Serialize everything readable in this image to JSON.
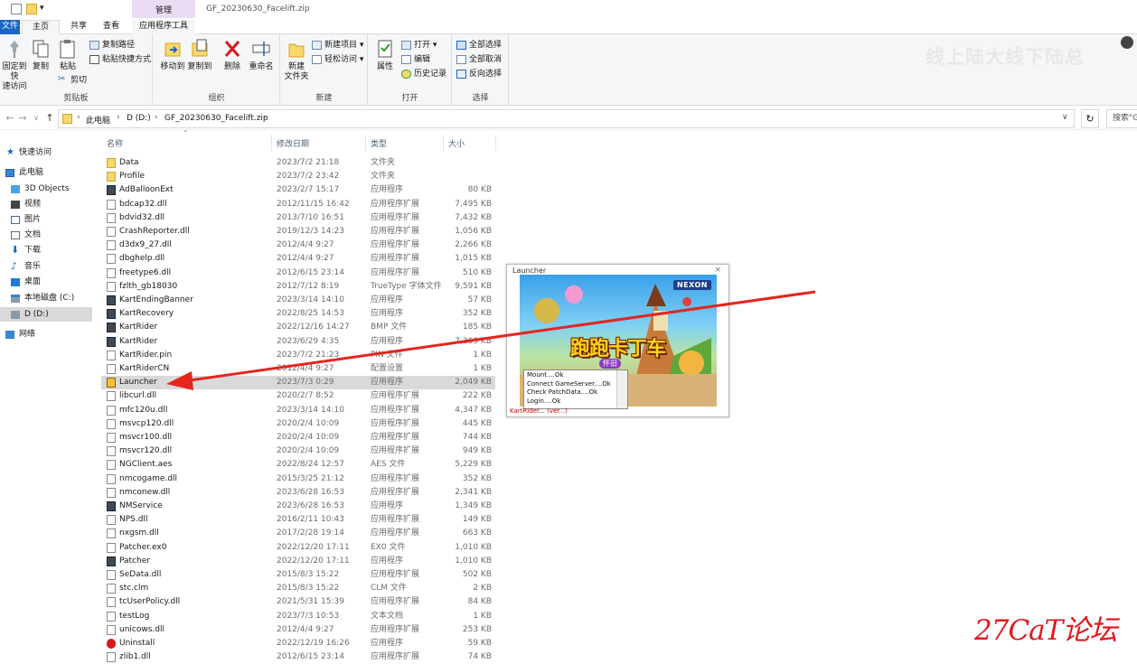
{
  "window": {
    "title": "GF_20230630_Facelift.zip",
    "manage_tab": "管理"
  },
  "ribbon_tabs": [
    {
      "label": "文件"
    },
    {
      "label": "主页"
    },
    {
      "label": "共享"
    },
    {
      "label": "查看"
    },
    {
      "label": "应用程序工具"
    }
  ],
  "ribbon": {
    "clipboard": {
      "pin_label_1": "固定到快",
      "pin_label_2": "速访问",
      "copy": "复制",
      "paste": "粘贴",
      "copy_path": "复制路径",
      "paste_shortcut": "粘贴快捷方式",
      "cut": "剪切",
      "group": "剪贴板"
    },
    "organize": {
      "move_to": "移动到",
      "copy_to": "复制到",
      "delete": "删除",
      "rename": "重命名",
      "group": "组织"
    },
    "new": {
      "new_folder_1": "新建",
      "new_folder_2": "文件夹",
      "new_item": "新建项目",
      "easy_access": "轻松访问",
      "group": "新建"
    },
    "open": {
      "properties": "属性",
      "open": "打开",
      "edit": "编辑",
      "history": "历史记录",
      "group": "打开"
    },
    "select": {
      "select_all": "全部选择",
      "select_none": "全部取消",
      "invert": "反向选择",
      "group": "选择"
    },
    "watermark": "线上陆大线下陆总",
    "colors": {
      "accent": "#1a66c4",
      "manage_tab": "#eadcf2"
    }
  },
  "address": {
    "crumbs": [
      "此电脑",
      "D (D:)",
      "GF_20230630_Facelift.zip"
    ],
    "search_placeholder": "搜索\"GF"
  },
  "nav": {
    "items": [
      {
        "label": "快速访问",
        "icon": "star-icon"
      },
      {
        "label": "此电脑",
        "icon": "computer-icon"
      },
      {
        "label": "3D Objects",
        "icon": "cube-icon"
      },
      {
        "label": "视频",
        "icon": "video-icon"
      },
      {
        "label": "图片",
        "icon": "picture-icon"
      },
      {
        "label": "文档",
        "icon": "document-icon"
      },
      {
        "label": "下载",
        "icon": "download-icon"
      },
      {
        "label": "音乐",
        "icon": "music-icon"
      },
      {
        "label": "桌面",
        "icon": "desktop-icon"
      },
      {
        "label": "本地磁盘 (C:)",
        "icon": "drive-icon"
      },
      {
        "label": "D (D:)",
        "icon": "drive-icon"
      },
      {
        "label": "网络",
        "icon": "network-icon"
      }
    ]
  },
  "columns": {
    "name": "名称",
    "date": "修改日期",
    "type": "类型",
    "size": "大小"
  },
  "files": [
    {
      "name": "Data",
      "date": "2023/7/2 21:18",
      "type": "文件夹",
      "size": "",
      "icon": "folder-icon"
    },
    {
      "name": "Profile",
      "date": "2023/7/2 23:42",
      "type": "文件夹",
      "size": "",
      "icon": "folder-icon"
    },
    {
      "name": "AdBalloonExt",
      "date": "2023/2/7 15:17",
      "type": "应用程序",
      "size": "80 KB",
      "icon": "app-icon"
    },
    {
      "name": "bdcap32.dll",
      "date": "2012/11/15 16:42",
      "type": "应用程序扩展",
      "size": "7,495 KB",
      "icon": "dll-icon"
    },
    {
      "name": "bdvid32.dll",
      "date": "2013/7/10 16:51",
      "type": "应用程序扩展",
      "size": "7,432 KB",
      "icon": "dll-icon"
    },
    {
      "name": "CrashReporter.dll",
      "date": "2019/12/3 14:23",
      "type": "应用程序扩展",
      "size": "1,056 KB",
      "icon": "dll-icon"
    },
    {
      "name": "d3dx9_27.dll",
      "date": "2012/4/4 9:27",
      "type": "应用程序扩展",
      "size": "2,266 KB",
      "icon": "dll-icon"
    },
    {
      "name": "dbghelp.dll",
      "date": "2012/4/4 9:27",
      "type": "应用程序扩展",
      "size": "1,015 KB",
      "icon": "dll-icon"
    },
    {
      "name": "freetype6.dll",
      "date": "2012/6/15 23:14",
      "type": "应用程序扩展",
      "size": "510 KB",
      "icon": "dll-icon"
    },
    {
      "name": "fzlth_gb18030",
      "date": "2012/7/12 8:19",
      "type": "TrueType 字体文件",
      "size": "9,591 KB",
      "icon": "file-icon"
    },
    {
      "name": "KartEndingBanner",
      "date": "2023/3/14 14:10",
      "type": "应用程序",
      "size": "57 KB",
      "icon": "app-icon"
    },
    {
      "name": "KartRecovery",
      "date": "2022/8/25 14:53",
      "type": "应用程序",
      "size": "352 KB",
      "icon": "app-icon"
    },
    {
      "name": "KartRider",
      "date": "2022/12/16 14:27",
      "type": "BMP 文件",
      "size": "185 KB",
      "icon": "app-icon"
    },
    {
      "name": "KartRider",
      "date": "2023/6/29 4:35",
      "type": "应用程序",
      "size": "7,303 KB",
      "icon": "app-icon"
    },
    {
      "name": "KartRider.pin",
      "date": "2023/7/2 21:23",
      "type": "PIN 文件",
      "size": "1 KB",
      "icon": "file-icon"
    },
    {
      "name": "KartRiderCN",
      "date": "2012/4/4 9:27",
      "type": "配置设置",
      "size": "1 KB",
      "icon": "file-icon"
    },
    {
      "name": "Launcher",
      "date": "2023/7/3 0:29",
      "type": "应用程序",
      "size": "2,049 KB",
      "icon": "launcher-icon",
      "selected": true
    },
    {
      "name": "libcurl.dll",
      "date": "2020/2/7 8:52",
      "type": "应用程序扩展",
      "size": "222 KB",
      "icon": "dll-icon"
    },
    {
      "name": "mfc120u.dll",
      "date": "2023/3/14 14:10",
      "type": "应用程序扩展",
      "size": "4,347 KB",
      "icon": "dll-icon"
    },
    {
      "name": "msvcp120.dll",
      "date": "2020/2/4 10:09",
      "type": "应用程序扩展",
      "size": "445 KB",
      "icon": "dll-icon"
    },
    {
      "name": "msvcr100.dll",
      "date": "2020/2/4 10:09",
      "type": "应用程序扩展",
      "size": "744 KB",
      "icon": "dll-icon"
    },
    {
      "name": "msvcr120.dll",
      "date": "2020/2/4 10:09",
      "type": "应用程序扩展",
      "size": "949 KB",
      "icon": "dll-icon"
    },
    {
      "name": "NGClient.aes",
      "date": "2022/8/24 12:57",
      "type": "AES 文件",
      "size": "5,229 KB",
      "icon": "file-icon"
    },
    {
      "name": "nmcogame.dll",
      "date": "2015/3/25 21:12",
      "type": "应用程序扩展",
      "size": "352 KB",
      "icon": "dll-icon"
    },
    {
      "name": "nmconew.dll",
      "date": "2023/6/28 16:53",
      "type": "应用程序扩展",
      "size": "2,341 KB",
      "icon": "dll-icon"
    },
    {
      "name": "NMService",
      "date": "2023/6/28 16:53",
      "type": "应用程序",
      "size": "1,349 KB",
      "icon": "app-icon"
    },
    {
      "name": "NPS.dll",
      "date": "2016/2/11 10:43",
      "type": "应用程序扩展",
      "size": "149 KB",
      "icon": "dll-icon"
    },
    {
      "name": "nxgsm.dll",
      "date": "2017/2/28 19:14",
      "type": "应用程序扩展",
      "size": "663 KB",
      "icon": "dll-icon"
    },
    {
      "name": "Patcher.ex0",
      "date": "2022/12/20 17:11",
      "type": "EX0 文件",
      "size": "1,010 KB",
      "icon": "file-icon"
    },
    {
      "name": "Patcher",
      "date": "2022/12/20 17:11",
      "type": "应用程序",
      "size": "1,010 KB",
      "icon": "app-icon"
    },
    {
      "name": "SeData.dll",
      "date": "2015/8/3 15:22",
      "type": "应用程序扩展",
      "size": "502 KB",
      "icon": "dll-icon"
    },
    {
      "name": "stc.clm",
      "date": "2015/8/3 15:22",
      "type": "CLM 文件",
      "size": "2 KB",
      "icon": "file-icon"
    },
    {
      "name": "tcUserPolicy.dll",
      "date": "2021/5/31 15:39",
      "type": "应用程序扩展",
      "size": "84 KB",
      "icon": "dll-icon"
    },
    {
      "name": "testLog",
      "date": "2023/7/3 10:53",
      "type": "文本文档",
      "size": "1 KB",
      "icon": "file-icon"
    },
    {
      "name": "unicows.dll",
      "date": "2012/4/4 9:27",
      "type": "应用程序扩展",
      "size": "253 KB",
      "icon": "dll-icon"
    },
    {
      "name": "Uninstall",
      "date": "2022/12/19 16:26",
      "type": "应用程序",
      "size": "59 KB",
      "icon": "uninstall-icon"
    },
    {
      "name": "zlib1.dll",
      "date": "2012/6/15 23:14",
      "type": "应用程序扩展",
      "size": "74 KB",
      "icon": "dll-icon"
    }
  ],
  "launcher": {
    "title": "Launcher",
    "close": "×",
    "brand": "NEXON",
    "game_logo": "跑跑卡丁车",
    "game_sub": "怀旧",
    "log_lines": [
      "Mount....Ok",
      "Connect GameServer....Ok",
      "Check PatchData....Ok",
      "Login....Ok"
    ],
    "status": "KartRider... (ver...)"
  },
  "watermark_bottom": "27CaT论坛"
}
